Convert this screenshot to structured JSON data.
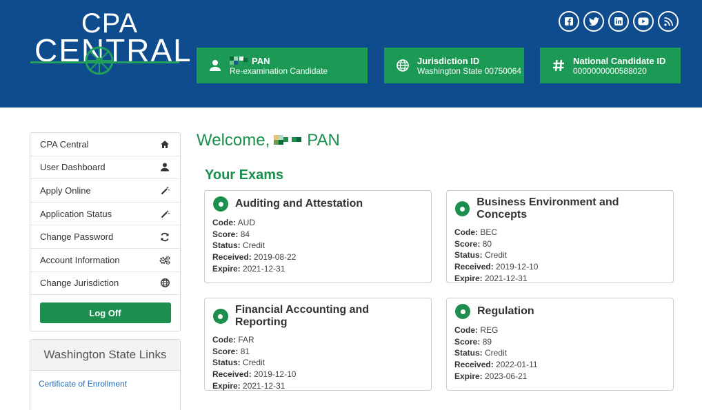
{
  "header": {
    "logo": {
      "line1": "CPA",
      "line2": "CENTRAL"
    },
    "social": [
      {
        "icon": "facebook-icon"
      },
      {
        "icon": "twitter-icon"
      },
      {
        "icon": "linkedin-icon"
      },
      {
        "icon": "youtube-icon"
      },
      {
        "icon": "rss-icon"
      }
    ],
    "candidate": {
      "name": "PAN",
      "type": "Re-examination Candidate"
    },
    "jurisdiction": {
      "title": "Jurisdiction ID",
      "value": "Washington State 00750064"
    },
    "national": {
      "title": "National Candidate ID",
      "value": "0000000000588020"
    }
  },
  "sidebar": {
    "items": [
      {
        "label": "CPA Central",
        "icon": "home-icon"
      },
      {
        "label": "User Dashboard",
        "icon": "user-icon"
      },
      {
        "label": "Apply Online",
        "icon": "wand-icon"
      },
      {
        "label": "Application Status",
        "icon": "wand-icon"
      },
      {
        "label": "Change Password",
        "icon": "refresh-icon"
      },
      {
        "label": "Account Information",
        "icon": "gears-icon"
      },
      {
        "label": "Change Jurisdiction",
        "icon": "globe-icon"
      }
    ],
    "logoff_label": "Log Off"
  },
  "links": {
    "title": "Washington State Links",
    "items": [
      "Certificate of Enrollment"
    ]
  },
  "main": {
    "welcome_prefix": "Welcome,",
    "welcome_name": "PAN",
    "exams_title": "Your Exams",
    "labels": {
      "code": "Code:",
      "score": "Score:",
      "status": "Status:",
      "received": "Received:",
      "expire": "Expire:"
    },
    "exams": [
      {
        "name": "Auditing and Attestation",
        "code": "AUD",
        "score": "84",
        "status": "Credit",
        "received": "2019-08-22",
        "expire": "2021-12-31"
      },
      {
        "name": "Business Environment and Concepts",
        "code": "BEC",
        "score": "80",
        "status": "Credit",
        "received": "2019-12-10",
        "expire": "2021-12-31"
      },
      {
        "name": "Financial Accounting and Reporting",
        "code": "FAR",
        "score": "81",
        "status": "Credit",
        "received": "2019-12-10",
        "expire": "2021-12-31"
      },
      {
        "name": "Regulation",
        "code": "REG",
        "score": "89",
        "status": "Credit",
        "received": "2022-01-11",
        "expire": "2023-06-21"
      }
    ]
  },
  "colors": {
    "header_bg": "#0f4c8e",
    "accent_green": "#1c9a55",
    "text_green": "#1c8e4d",
    "link_blue": "#2a6bb0"
  }
}
